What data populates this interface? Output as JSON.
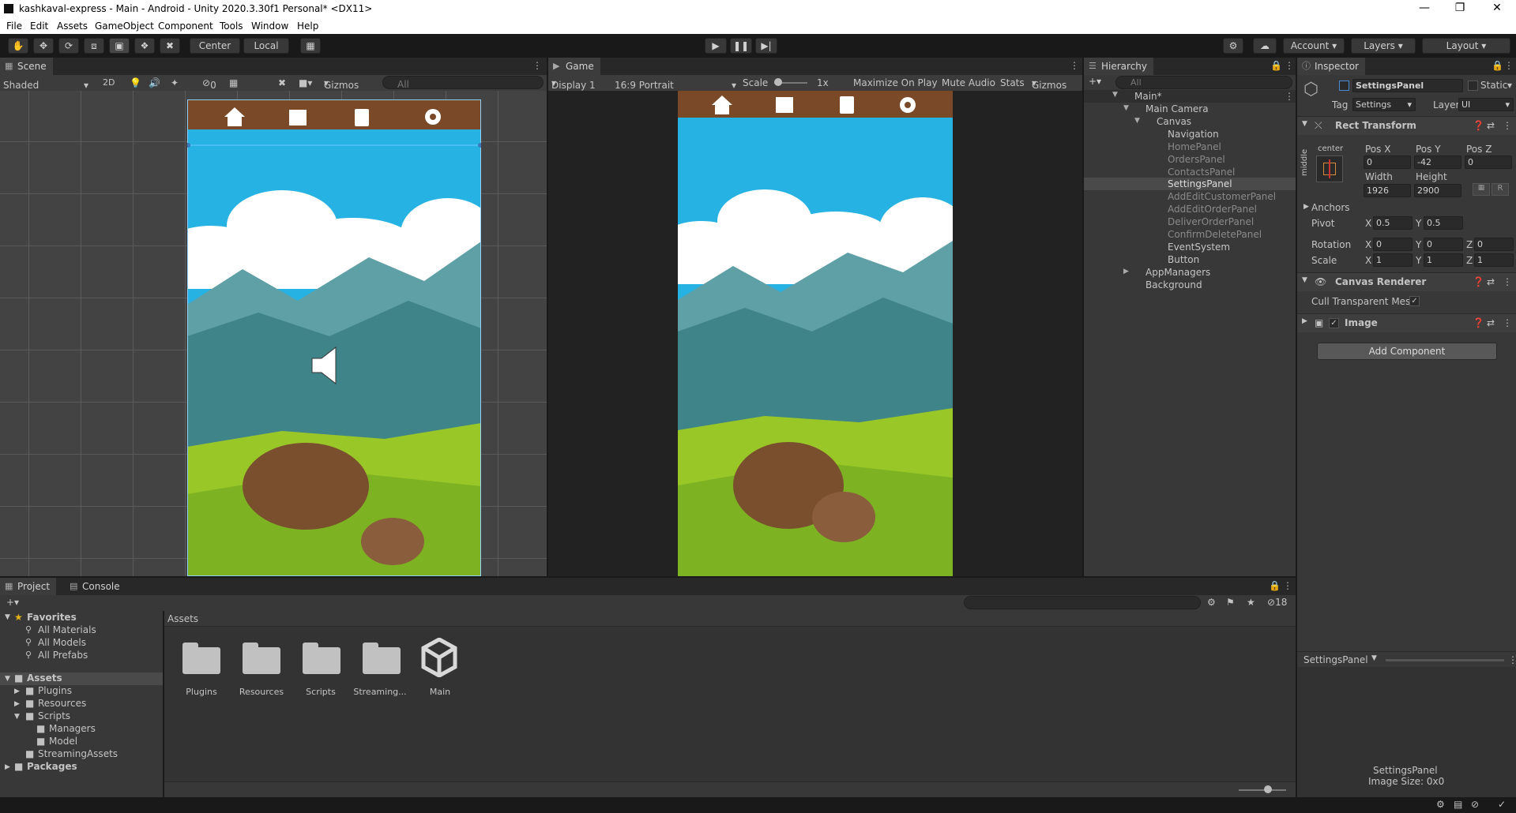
{
  "window": {
    "title": "kashkaval-express - Main - Android - Unity 2020.3.30f1 Personal* <DX11>"
  },
  "menu": [
    "File",
    "Edit",
    "Assets",
    "GameObject",
    "Component",
    "Tools",
    "Window",
    "Help"
  ],
  "toolbar": {
    "center": "Center",
    "local": "Local",
    "account": "Account",
    "layers": "Layers",
    "layout": "Layout"
  },
  "scene": {
    "tab": "Scene",
    "shading": "Shaded",
    "mode2d": "2D",
    "hidden_count": "0",
    "gizmos": "Gizmos",
    "search_placeholder": "All"
  },
  "game": {
    "tab": "Game",
    "display": "Display 1",
    "aspect": "16:9 Portrait",
    "scale_label": "Scale",
    "scale_value": "1x",
    "maximize": "Maximize On Play",
    "mute": "Mute Audio",
    "stats": "Stats",
    "gizmos": "Gizmos"
  },
  "hierarchy": {
    "tab": "Hierarchy",
    "search_placeholder": "All",
    "items": [
      {
        "label": "Main*",
        "depth": 0
      },
      {
        "label": "Main Camera",
        "depth": 1
      },
      {
        "label": "Canvas",
        "depth": 1
      },
      {
        "label": "Navigation",
        "depth": 2
      },
      {
        "label": "HomePanel",
        "depth": 2
      },
      {
        "label": "OrdersPanel",
        "depth": 2
      },
      {
        "label": "ContactsPanel",
        "depth": 2
      },
      {
        "label": "SettingsPanel",
        "depth": 2
      },
      {
        "label": "AddEditCustomerPanel",
        "depth": 2
      },
      {
        "label": "AddEditOrderPanel",
        "depth": 2
      },
      {
        "label": "DeliverOrderPanel",
        "depth": 2
      },
      {
        "label": "ConfirmDeletePanel",
        "depth": 2
      },
      {
        "label": "EventSystem",
        "depth": 2
      },
      {
        "label": "Button",
        "depth": 2
      },
      {
        "label": "AppManagers",
        "depth": 1
      },
      {
        "label": "Background",
        "depth": 1
      }
    ]
  },
  "inspector": {
    "tab": "Inspector",
    "object_name": "SettingsPanel",
    "static": "Static",
    "tag_label": "Tag",
    "tag": "Settings",
    "layer_label": "Layer",
    "layer": "UI",
    "rect_transform": "Rect Transform",
    "anchor_h": "center",
    "anchor_v": "middle",
    "posx_label": "Pos X",
    "posy_label": "Pos Y",
    "posz_label": "Pos Z",
    "posx": "0",
    "posy": "-42",
    "posz": "0",
    "width_label": "Width",
    "height_label": "Height",
    "width": "1926",
    "height": "2900",
    "r_btn": "R",
    "anchors": "Anchors",
    "pivot": "Pivot",
    "pivot_x": "0.5",
    "pivot_y": "0.5",
    "rotation": "Rotation",
    "rot_x": "0",
    "rot_y": "0",
    "rot_z": "0",
    "scale": "Scale",
    "scale_x": "1",
    "scale_y": "1",
    "scale_z": "1",
    "x": "X",
    "y": "Y",
    "z": "Z",
    "canvas_renderer": "Canvas Renderer",
    "cull": "Cull Transparent Mes",
    "image": "Image",
    "add_component": "Add Component",
    "preview_title": "SettingsPanel",
    "preview_name": "SettingsPanel",
    "preview_size": "Image Size: 0x0"
  },
  "project": {
    "tab_project": "Project",
    "tab_console": "Console",
    "favorites": "Favorites",
    "fav_items": [
      "All Materials",
      "All Models",
      "All Prefabs"
    ],
    "assets": "Assets",
    "tree": [
      "Plugins",
      "Resources",
      "Scripts",
      "Managers",
      "Model",
      "StreamingAssets"
    ],
    "packages": "Packages",
    "breadcrumb": "Assets",
    "hidden_count": "18",
    "grid": [
      "Plugins",
      "Resources",
      "Scripts",
      "Streaming...",
      "Main"
    ]
  },
  "colors": {
    "nav_bar": "#7a4a28",
    "sky": "#27b2e4",
    "selection": "#2c5d87",
    "accent": "#3a79bb"
  }
}
